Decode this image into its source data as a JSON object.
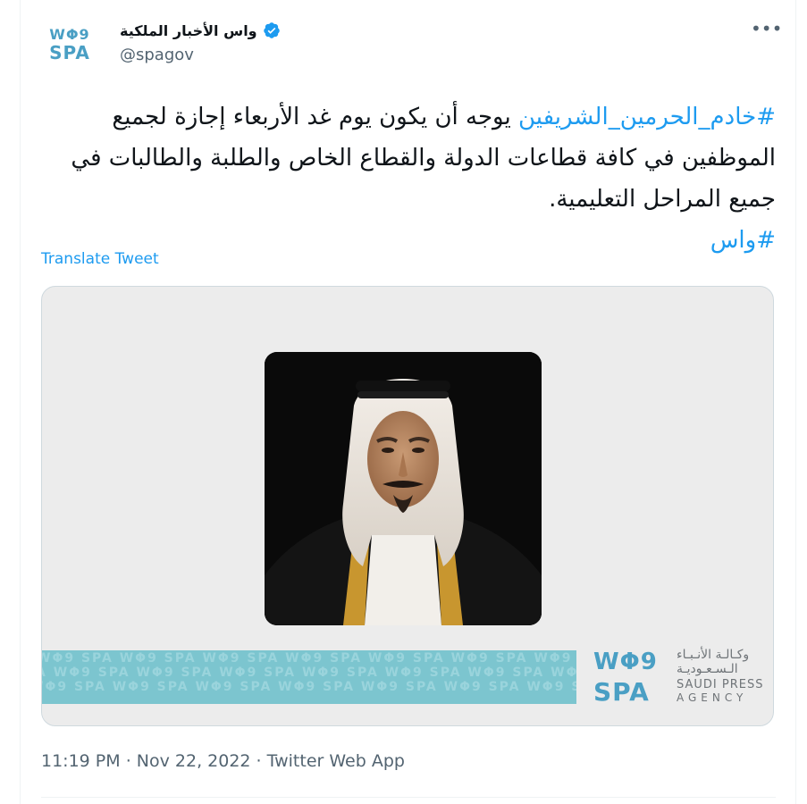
{
  "account": {
    "display_name": "واس الأخبار الملكية",
    "handle": "@spagov",
    "avatar_line1": "WΦ9",
    "avatar_line2": "SPA",
    "more_icon": "•••",
    "verified_icon": "verified-badge-icon"
  },
  "tweet": {
    "hashtag1": "#خادم_الحرمين_الشريفين",
    "body": " يوجه أن يكون يوم غد الأربعاء إجازة لجميع الموظفين في كافة قطاعات الدولة والقطاع الخاص والطلبة والطالبات في جميع المراحل التعليمية.",
    "hashtag2": "#واس",
    "translate_label": "Translate Tweet"
  },
  "media": {
    "brand_logo_line1": "WΦ9",
    "brand_logo_line2": "SPA",
    "brand_ar_line1": "وكـالـة الأنـبـاء",
    "brand_ar_line2": "الـسـعـوديـة",
    "brand_en_line1": "SAUDI PRESS",
    "brand_en_line2": "AGENCY"
  },
  "meta": {
    "time": "11:19 PM",
    "sep1": " · ",
    "date": "Nov 22, 2022",
    "sep2": " · ",
    "source": "Twitter Web App"
  },
  "colors": {
    "link": "#1d9bf0",
    "secondary_text": "#536471",
    "brand_blue": "#4a9fc4",
    "band_teal": "#7cc5cf"
  }
}
